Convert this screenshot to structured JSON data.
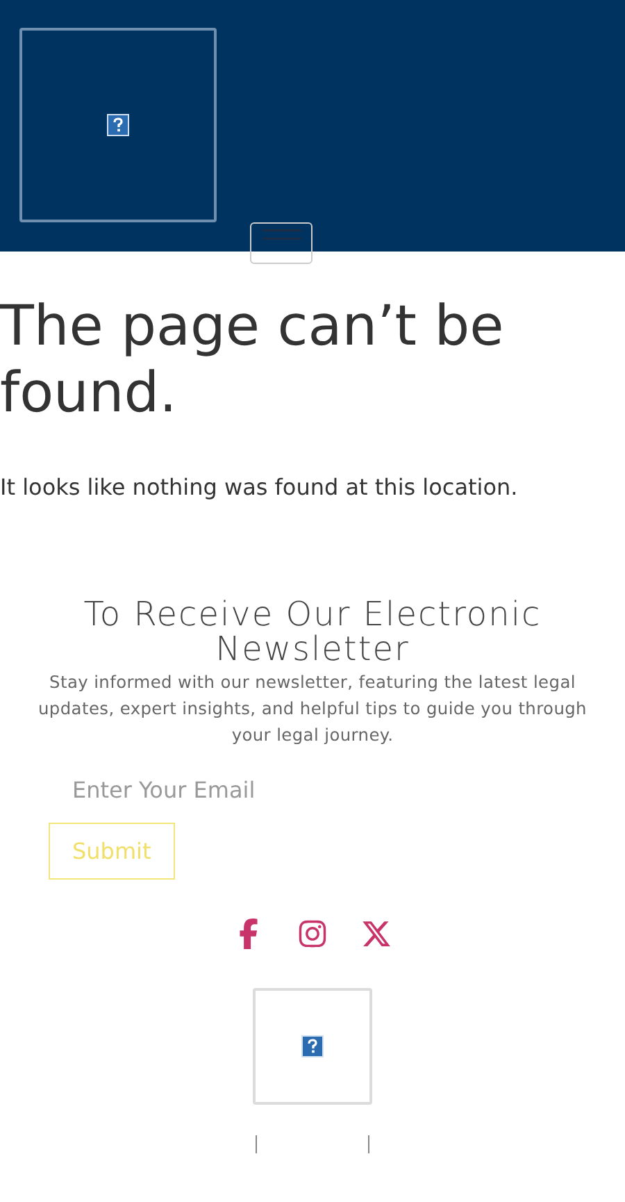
{
  "error": {
    "title": "The page can’t be found.",
    "message": "It looks like nothing was found at this location."
  },
  "newsletter": {
    "title": "To Receive Our Electronic Newsletter",
    "description": "Stay informed with our newsletter, featuring the latest legal updates, expert insights, and helpful tips to guide you through your legal journey.",
    "email": {
      "placeholder": "Enter Your Email"
    },
    "submit": "Submit"
  },
  "social": [
    {
      "kind": "facebook"
    },
    {
      "kind": "instagram"
    },
    {
      "kind": "x"
    }
  ]
}
